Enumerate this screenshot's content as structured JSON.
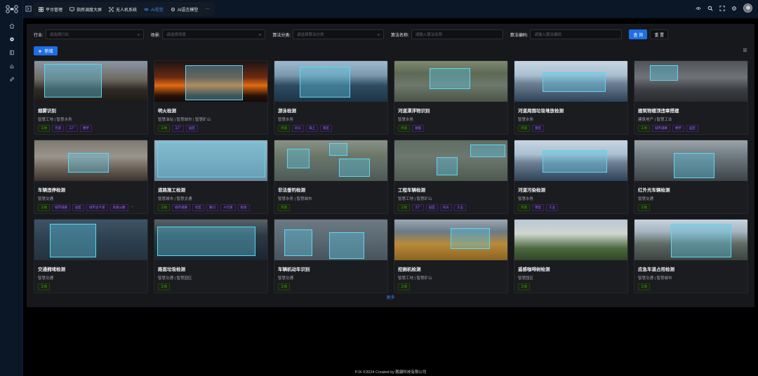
{
  "app": {
    "logo_icon": "drone-logo-icon"
  },
  "rail": {
    "items": [
      {
        "name": "home",
        "icon": "home-icon"
      },
      {
        "name": "settings",
        "icon": "gear-icon"
      },
      {
        "name": "book",
        "icon": "book-icon"
      },
      {
        "name": "chart",
        "icon": "chart-icon"
      },
      {
        "name": "link",
        "icon": "link-icon"
      }
    ]
  },
  "topnav": {
    "items": [
      {
        "label": "平台管理",
        "icon": "grid-icon",
        "active": false
      },
      {
        "label": "指挥调度大屏",
        "icon": "monitor-icon",
        "active": false
      },
      {
        "label": "无人机系统",
        "icon": "drone-icon",
        "active": false
      },
      {
        "label": "AI视觉",
        "icon": "ai-vision-icon",
        "active": true
      },
      {
        "label": "AI语言模型",
        "icon": "gear-icon",
        "active": false
      },
      {
        "label": "···",
        "icon": "",
        "active": false
      }
    ]
  },
  "filters": {
    "industry": {
      "label": "行业:",
      "placeholder": "请选择行业"
    },
    "scene": {
      "label": "场景:",
      "placeholder": "请选择场景"
    },
    "category": {
      "label": "算法分类:",
      "placeholder": "请选择算法分类"
    },
    "algo_name": {
      "label": "算法名称:",
      "placeholder": "请输入算法名称"
    },
    "algo_code": {
      "label": "算法编码:",
      "placeholder": "请输入算法编码"
    },
    "search_label": "查 询",
    "reset_label": "重 置"
  },
  "toolbar": {
    "add_label": "新增"
  },
  "cards": [
    {
      "title": "烟雾识别",
      "sub": "智慧工地 | 智慧水务",
      "tags": [
        [
          "工地",
          "g"
        ],
        [
          "河道",
          "p"
        ],
        [
          "工厂",
          "p"
        ],
        [
          "楼宇",
          "p"
        ]
      ]
    },
    {
      "title": "明火检测",
      "sub": "智慧油站 | 智慧城市 | 智慧矿山",
      "tags": [
        [
          "工地",
          "g"
        ],
        [
          "工厂",
          "p"
        ],
        [
          "园区",
          "p"
        ]
      ]
    },
    {
      "title": "游泳检测",
      "sub": "智慧水务",
      "tags": [
        [
          "河道",
          "g"
        ],
        [
          "码头",
          "p"
        ],
        [
          "海上",
          "p"
        ],
        [
          "景区",
          "p"
        ]
      ]
    },
    {
      "title": "河道漂浮物识别",
      "sub": "智慧水务",
      "tags": [
        [
          "河道",
          "g"
        ],
        [
          "湖面",
          "p"
        ]
      ]
    },
    {
      "title": "河道周围垃圾堆放检测",
      "sub": "智慧水务",
      "tags": [
        [
          "河道",
          "g"
        ],
        [
          "景区",
          "p"
        ]
      ]
    },
    {
      "title": "建筑物楼顶违章搭建",
      "sub": "建筑地产 | 智慧工业",
      "tags": [
        [
          "工地",
          "g"
        ],
        [
          "城市道路",
          "p"
        ],
        [
          "楼宇",
          "p"
        ],
        [
          "园区",
          "p"
        ]
      ]
    },
    {
      "title": "车辆违停检测",
      "sub": "智慧交通",
      "tags": [
        [
          "工地",
          "g"
        ],
        [
          "城市道路",
          "p"
        ],
        [
          "园区",
          "p"
        ],
        [
          "城市主干道",
          "p"
        ],
        [
          "高速公路",
          "p"
        ]
      ],
      "more": "···"
    },
    {
      "title": "道路施工检测",
      "sub": "智慧城市 | 智慧交通",
      "tags": [
        [
          "工地",
          "g"
        ],
        [
          "城市道路",
          "p"
        ],
        [
          "社区",
          "p"
        ],
        [
          "路口",
          "p"
        ],
        [
          "人行道",
          "p"
        ],
        [
          "街道",
          "p"
        ]
      ]
    },
    {
      "title": "非法垂钓检测",
      "sub": "智慧水务 | 智慧城市",
      "tags": [
        [
          "河道",
          "g"
        ]
      ]
    },
    {
      "title": "工程车辆检测",
      "sub": "智慧工地 | 智慧矿山",
      "tags": [
        [
          "工地",
          "g"
        ],
        [
          "工厂",
          "p"
        ],
        [
          "园区",
          "p"
        ],
        [
          "码头",
          "p"
        ],
        [
          "工业",
          "p"
        ]
      ]
    },
    {
      "title": "河道污染检测",
      "sub": "智慧水务",
      "tags": [
        [
          "河道",
          "g"
        ],
        [
          "景区",
          "p"
        ],
        [
          "工业",
          "p"
        ]
      ]
    },
    {
      "title": "红外光车辆检测",
      "sub": "智慧交通",
      "tags": [
        [
          "工地",
          "g"
        ]
      ]
    },
    {
      "title": "交通拥堵检测",
      "sub": "智慧交通",
      "tags": [
        [
          "工地",
          "g"
        ]
      ]
    },
    {
      "title": "路面垃圾检测",
      "sub": "智慧交通 | 智慧园区",
      "tags": [
        [
          "工地",
          "g"
        ]
      ]
    },
    {
      "title": "车辆机动车识别",
      "sub": "智慧交通",
      "tags": [
        [
          "工地",
          "g"
        ]
      ]
    },
    {
      "title": "挖掘机检测",
      "sub": "智慧工地 | 智慧矿山",
      "tags": [
        [
          "工地",
          "g"
        ]
      ]
    },
    {
      "title": "遥感咖啡树检测",
      "sub": "智慧园区",
      "tags": [
        [
          "工地",
          "g"
        ]
      ]
    },
    {
      "title": "应急车道占用检测",
      "sub": "智慧交通 | 智慧城市",
      "tags": [
        [
          "工地",
          "g"
        ]
      ]
    }
  ],
  "more_label": "更多",
  "footer": "PJX ©2024 Created by 鹏骧科技有限公司"
}
